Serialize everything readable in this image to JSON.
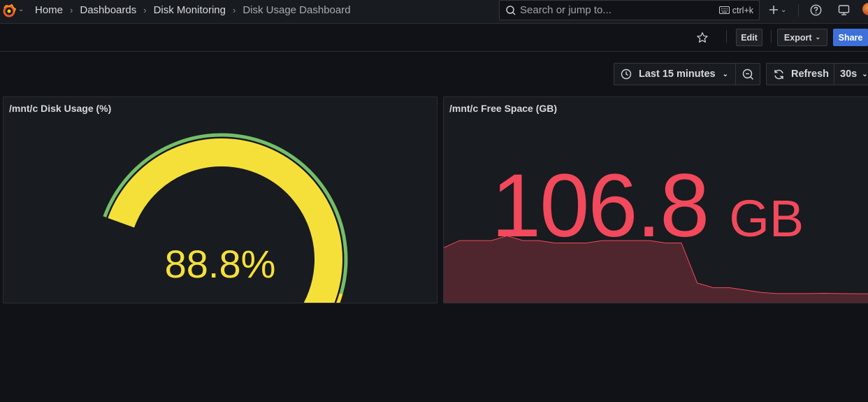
{
  "topbar": {
    "breadcrumb": [
      "Home",
      "Dashboards",
      "Disk Monitoring",
      "Disk Usage Dashboard"
    ],
    "search_placeholder": "Search or jump to...",
    "search_shortcut": "ctrl+k"
  },
  "actionbar": {
    "edit_label": "Edit",
    "export_label": "Export",
    "share_label": "Share"
  },
  "timepicker": {
    "range_label": "Last 15 minutes",
    "refresh_label": "Refresh",
    "interval_label": "30s"
  },
  "panels": {
    "gauge": {
      "title": "/mnt/c Disk Usage (%)",
      "value_text": "88.8%",
      "value": 88.8,
      "min": 0,
      "max": 100,
      "thresholds": [
        {
          "from": 0,
          "to": 80,
          "color": "#73bf69"
        },
        {
          "from": 80,
          "to": 95,
          "color": "#fade2a"
        },
        {
          "from": 95,
          "to": 100,
          "color": "#f2495c"
        }
      ],
      "value_color": "#f5e03a"
    },
    "stat": {
      "title": "/mnt/c Free Space (GB)",
      "value": "106.8",
      "unit": "GB",
      "color": "#f2495c",
      "sparkline": [
        128,
        131,
        131,
        131,
        133,
        131,
        131,
        130,
        130,
        130,
        131,
        131,
        131,
        131,
        130,
        130,
        113,
        111,
        111,
        110,
        109,
        108.5,
        108.5,
        108.5,
        108.6,
        108.5,
        108.4,
        108.4
      ]
    }
  },
  "icons": [
    "grafana-logo-icon",
    "search-icon",
    "keyboard-icon",
    "plus-icon",
    "help-icon",
    "tv-icon",
    "star-icon",
    "clock-icon",
    "zoom-out-icon",
    "refresh-icon",
    "chevron-down-icon"
  ]
}
